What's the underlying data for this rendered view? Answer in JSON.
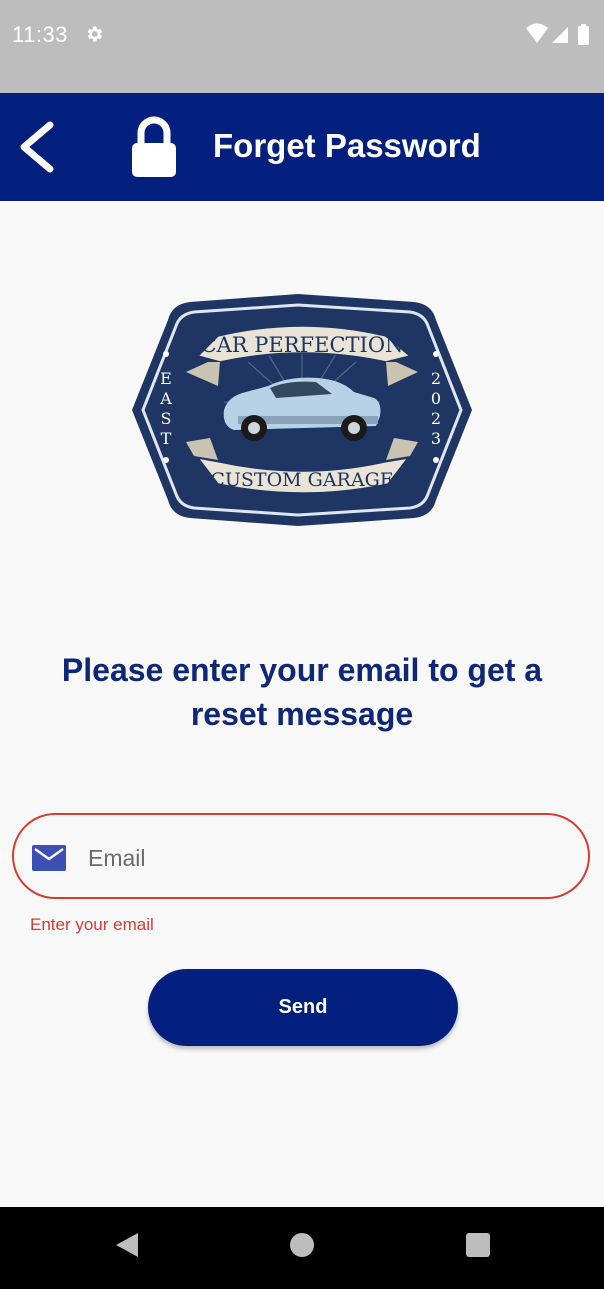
{
  "status_bar": {
    "time": "11:33",
    "icons": [
      "settings-icon",
      "wifi-icon",
      "signal-icon",
      "battery-icon"
    ]
  },
  "app_bar": {
    "title": "Forget Password",
    "back_icon": "chevron-left-icon",
    "lock_icon": "lock-icon",
    "background": "#04207e"
  },
  "logo": {
    "top_text": "CAR PERFECTION",
    "bottom_text": "CUSTOM GARAGE",
    "left_text": "EAST",
    "right_text": "2023",
    "color": "#1f3563"
  },
  "main": {
    "heading": "Please enter your email to get a reset message"
  },
  "email_field": {
    "placeholder": "Email",
    "value": "",
    "icon": "mail-icon",
    "error": "Enter your email",
    "error_color": "#d83b30"
  },
  "send_button": {
    "label": "Send"
  },
  "nav_bar": {
    "icons": [
      "back-triangle-icon",
      "home-circle-icon",
      "recents-square-icon"
    ]
  }
}
